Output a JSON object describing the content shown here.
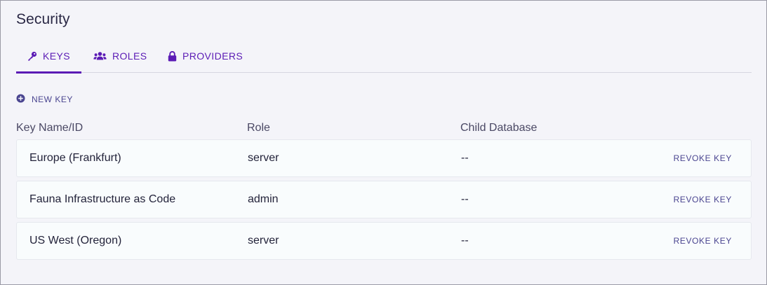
{
  "page": {
    "title": "Security"
  },
  "tabs": [
    {
      "label": "KEYS",
      "icon": "key-icon",
      "active": true
    },
    {
      "label": "ROLES",
      "icon": "users-icon",
      "active": false
    },
    {
      "label": "PROVIDERS",
      "icon": "lock-icon",
      "active": false
    }
  ],
  "actions": {
    "new_key_label": "NEW KEY",
    "new_key_icon": "plus-circle-icon"
  },
  "table": {
    "columns": [
      "Key Name/ID",
      "Role",
      "Child Database"
    ],
    "rows": [
      {
        "name": "Europe (Frankfurt)",
        "role": "server",
        "child_database": "--",
        "action": "REVOKE KEY"
      },
      {
        "name": "Fauna Infrastructure as Code",
        "role": "admin",
        "child_database": "--",
        "action": "REVOKE KEY"
      },
      {
        "name": "US West (Oregon)",
        "role": "server",
        "child_database": "--",
        "action": "REVOKE KEY"
      }
    ]
  },
  "colors": {
    "accent": "#5b1bb5",
    "action_text": "#4a4590",
    "background": "#f4f4f9"
  }
}
